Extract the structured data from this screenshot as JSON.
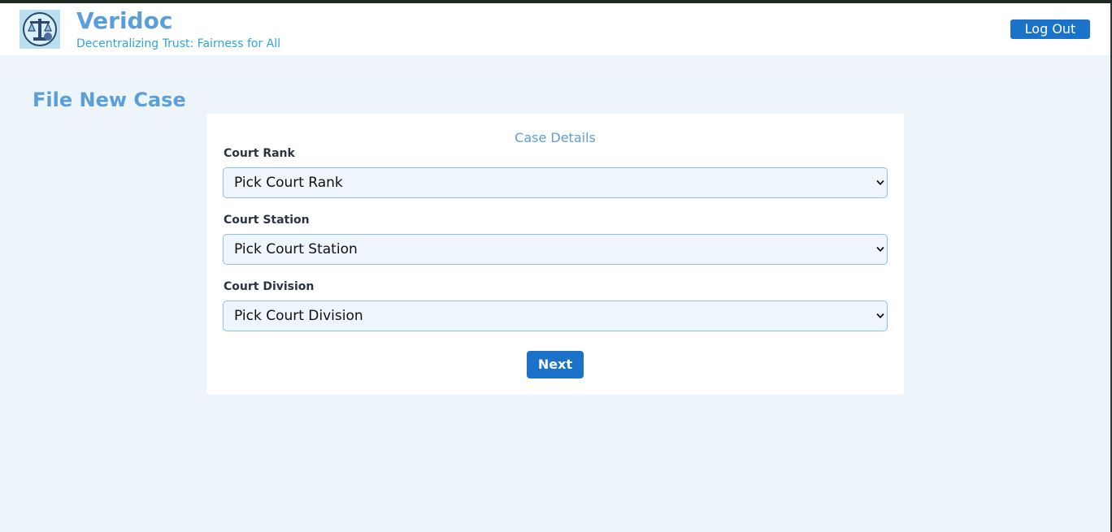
{
  "header": {
    "brand_name": "Veridoc",
    "tagline": "Decentralizing Trust: Fairness for All",
    "logout_label": "Log Out"
  },
  "page": {
    "title": "File New Case"
  },
  "form": {
    "heading": "Case Details",
    "fields": [
      {
        "label": "Court Rank",
        "value": "Pick Court Rank"
      },
      {
        "label": "Court Station",
        "value": "Pick Court Station"
      },
      {
        "label": "Court Division",
        "value": "Pick Court Division"
      }
    ],
    "next_label": "Next"
  },
  "colors": {
    "accent": "#1b72c9",
    "brand": "#5a9fd8",
    "tagline": "#2ea5d8",
    "page_background": "#edf5fb"
  },
  "icons": {
    "logo": "justice-scales-logo-icon",
    "select_arrow": "chevron-down-icon"
  }
}
